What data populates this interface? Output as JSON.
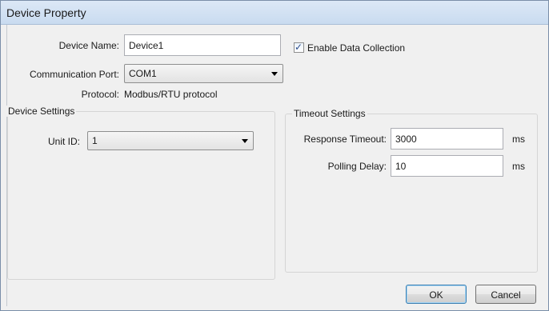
{
  "window": {
    "title": "Device Property"
  },
  "device": {
    "name_label": "Device Name:",
    "name_value": "Device1",
    "enable_label": "Enable Data Collection",
    "enable_checked": true,
    "port_label": "Communication Port:",
    "port_value": "COM1",
    "protocol_label": "Protocol:",
    "protocol_value": "Modbus/RTU protocol"
  },
  "device_settings": {
    "title": "Device Settings",
    "unit_id_label": "Unit ID:",
    "unit_id_value": "1"
  },
  "timeout_settings": {
    "title": "Timeout Settings",
    "response_label": "Response Timeout:",
    "response_value": "3000",
    "response_unit": "ms",
    "polling_label": "Polling Delay:",
    "polling_value": "10",
    "polling_unit": "ms"
  },
  "buttons": {
    "ok": "OK",
    "cancel": "Cancel"
  }
}
